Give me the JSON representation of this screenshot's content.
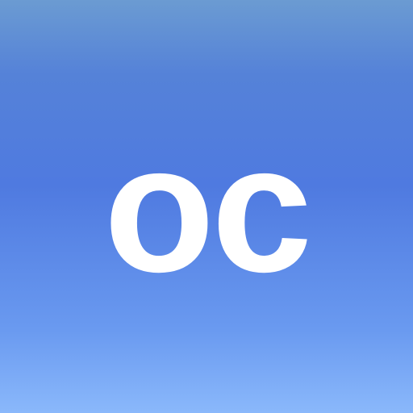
{
  "app_icon": {
    "monogram": "oc",
    "colors": {
      "gradient_top": "#6b9bd2",
      "gradient_mid": "#4f7ae0",
      "gradient_bottom": "#8ab8fb",
      "text": "#ffffff"
    }
  }
}
